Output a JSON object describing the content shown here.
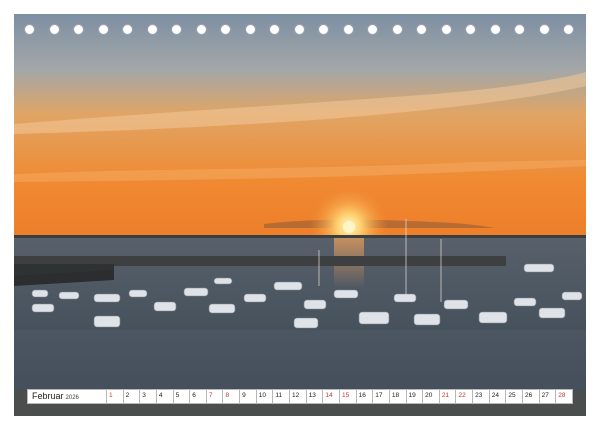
{
  "calendar": {
    "month": "Februar",
    "year": "2026",
    "days": [
      {
        "n": "1",
        "weekend": true
      },
      {
        "n": "2",
        "weekend": false
      },
      {
        "n": "3",
        "weekend": false
      },
      {
        "n": "4",
        "weekend": false
      },
      {
        "n": "5",
        "weekend": false
      },
      {
        "n": "6",
        "weekend": false
      },
      {
        "n": "7",
        "weekend": true
      },
      {
        "n": "8",
        "weekend": true
      },
      {
        "n": "9",
        "weekend": false
      },
      {
        "n": "10",
        "weekend": false
      },
      {
        "n": "11",
        "weekend": false
      },
      {
        "n": "12",
        "weekend": false
      },
      {
        "n": "13",
        "weekend": false
      },
      {
        "n": "14",
        "weekend": true
      },
      {
        "n": "15",
        "weekend": true
      },
      {
        "n": "16",
        "weekend": false
      },
      {
        "n": "17",
        "weekend": false
      },
      {
        "n": "18",
        "weekend": false
      },
      {
        "n": "19",
        "weekend": false
      },
      {
        "n": "20",
        "weekend": false
      },
      {
        "n": "21",
        "weekend": true
      },
      {
        "n": "22",
        "weekend": true
      },
      {
        "n": "23",
        "weekend": false
      },
      {
        "n": "24",
        "weekend": false
      },
      {
        "n": "25",
        "weekend": false
      },
      {
        "n": "26",
        "weekend": false
      },
      {
        "n": "27",
        "weekend": false
      },
      {
        "n": "28",
        "weekend": true
      }
    ]
  },
  "photo": {
    "subject": "sunset-harbor-photo"
  },
  "binding": {
    "hole_count": 23
  },
  "colors": {
    "sky_top": "#7f93a8",
    "sky_mid": "#e6a764",
    "horizon": "#f2862a",
    "sun": "#fff3c0",
    "sea": "#3e4a55",
    "weekend_red": "#c0392b"
  }
}
